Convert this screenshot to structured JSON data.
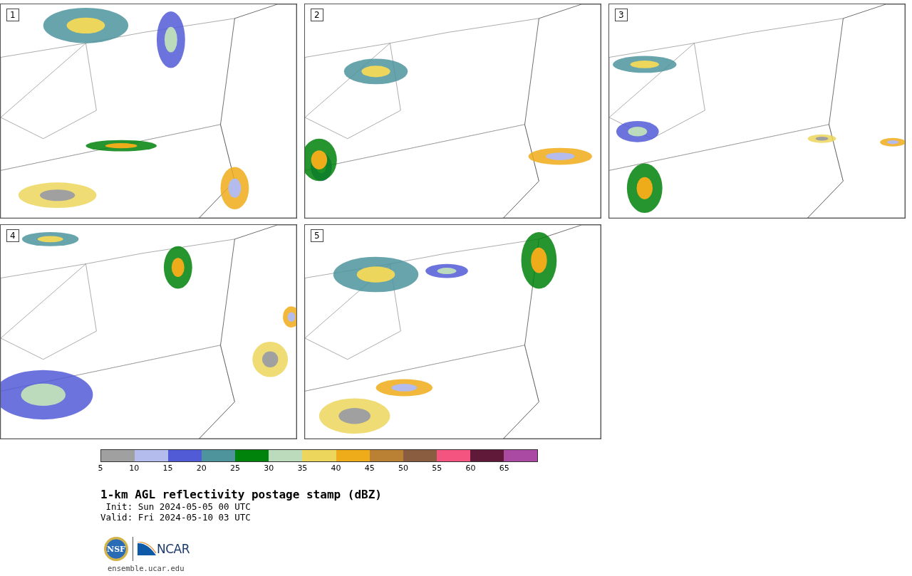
{
  "panels": [
    {
      "label": "1"
    },
    {
      "label": "2"
    },
    {
      "label": "3"
    },
    {
      "label": "4"
    },
    {
      "label": "5"
    }
  ],
  "colorbar": {
    "bins": [
      {
        "color": "#a0a0a0"
      },
      {
        "color": "#b4bced"
      },
      {
        "color": "#525bd6"
      },
      {
        "color": "#4e949c"
      },
      {
        "color": "#00830a"
      },
      {
        "color": "#bcdbbc"
      },
      {
        "color": "#ecd65c"
      },
      {
        "color": "#eeac1a"
      },
      {
        "color": "#ba8033"
      },
      {
        "color": "#8a5c40"
      },
      {
        "color": "#f45480"
      },
      {
        "color": "#611939"
      },
      {
        "color": "#aa4aa2"
      }
    ],
    "ticks": [
      "5",
      "10",
      "15",
      "20",
      "25",
      "30",
      "35",
      "40",
      "45",
      "50",
      "55",
      "60",
      "65"
    ]
  },
  "title": "1-km AGL reflectivity postage stamp (dBZ)",
  "init": " Init: Sun 2024-05-05 00 UTC",
  "valid": "Valid: Fri 2024-05-10 03 UTC",
  "logos": {
    "seal_text": "NSF",
    "wordmark": "NCAR"
  },
  "site": "ensemble.ucar.edu"
}
